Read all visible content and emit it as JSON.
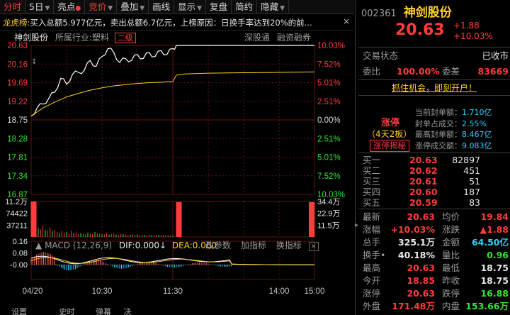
{
  "toolbar": {
    "items": [
      {
        "label": "分时",
        "active": true
      },
      {
        "label": "5日",
        "arrow": true
      },
      {
        "label": "亮点",
        "dot": true
      },
      {
        "label": "竞价",
        "active": true,
        "arrow": true
      },
      {
        "label": "叠加",
        "arrow": true
      },
      {
        "label": "画线"
      },
      {
        "label": "显示",
        "arrow": true
      },
      {
        "label": "复盘"
      },
      {
        "label": "简约"
      },
      {
        "label": "隐藏",
        "arrow": true
      }
    ]
  },
  "headline": {
    "label": "龙虎榜:",
    "text": "买入总额5.977亿元，卖出总额6.7亿元，上榜原因：日换手率达到20%的前...",
    "close": "×"
  },
  "chart": {
    "stock_name": "神剑股份",
    "industry_label": "所属行业:",
    "industry": "塑料",
    "tag": "二级",
    "link1": "深股通",
    "link2": "融资融券",
    "expand_icon": "↕"
  },
  "macd": {
    "title": "MACD (12,26,9)",
    "dif_label": "DIF:",
    "dif": "0.000",
    "dea_label": "DEA:",
    "dea": "0.000",
    "macd_label": "MACD:",
    "macd": "0.000",
    "btn_modify": "改参数",
    "btn_add": "加指标",
    "btn_switch": "换指标",
    "btn_close": "×"
  },
  "chart_data": [
    {
      "type": "line",
      "title": "",
      "x_ticks": [
        "04/20",
        "10:30",
        "11:30",
        "14:00",
        "15:00"
      ],
      "y_left_ticks": [
        "20.63",
        "20.16",
        "19.69",
        "19.22",
        "18.75",
        "18.28",
        "17.81",
        "17.34",
        "16.87"
      ],
      "y_right_ticks": [
        "10.03%",
        "7.52%",
        "5.01%",
        "2.51%",
        "0.00%",
        "2.51%",
        "5.01%",
        "7.52%",
        "10.03%"
      ],
      "ylim": [
        16.87,
        20.63
      ],
      "prev_close": 18.75,
      "series": [
        {
          "x": [
            0,
            5,
            10,
            15,
            20,
            25,
            30,
            35,
            40,
            45,
            50,
            55,
            60,
            65,
            70,
            75,
            80,
            85,
            90,
            95,
            100,
            105,
            110,
            115,
            120,
            123,
            130,
            150,
            180,
            210,
            240
          ],
          "values": [
            18.85,
            19.05,
            19.15,
            19.3,
            19.45,
            19.8,
            19.65,
            19.9,
            19.95,
            20.0,
            20.25,
            20.1,
            20.35,
            20.55,
            20.45,
            20.2,
            20.3,
            20.25,
            20.4,
            20.3,
            20.45,
            20.35,
            20.5,
            20.4,
            20.55,
            20.63,
            20.63,
            20.63,
            20.63,
            20.63,
            20.63
          ],
          "color": "#ffffff"
        },
        {
          "x": [
            0,
            5,
            10,
            20,
            30,
            40,
            50,
            60,
            70,
            80,
            90,
            100,
            110,
            120,
            123,
            130,
            150,
            180,
            210,
            240
          ],
          "values": [
            18.85,
            18.95,
            19.05,
            19.2,
            19.33,
            19.42,
            19.5,
            19.56,
            19.61,
            19.64,
            19.67,
            19.69,
            19.7,
            19.72,
            19.88,
            19.91,
            19.93,
            19.94,
            19.95,
            19.96
          ],
          "color": "#ffd21f"
        }
      ]
    },
    {
      "type": "bar",
      "title": "",
      "y_left_ticks": [
        "11.2万",
        "74422",
        "37211"
      ],
      "y_right_ticks": [
        "34.4万",
        "22.9万",
        "11.5万"
      ],
      "x": [
        0,
        2,
        4,
        6,
        8,
        10,
        12,
        14,
        16,
        18,
        20,
        22,
        24,
        26,
        28,
        30,
        32,
        34,
        36,
        38,
        40,
        42,
        44,
        46,
        48,
        50,
        52,
        54,
        56,
        58,
        60,
        62,
        64,
        66,
        68,
        70,
        72,
        74,
        76,
        78,
        80,
        82,
        84,
        86,
        88,
        90,
        92,
        94,
        96,
        98,
        100,
        102,
        104,
        106,
        108,
        110,
        112,
        114,
        116,
        118,
        120,
        123
      ],
      "values": [
        11.2,
        4.0,
        3.2,
        2.8,
        2.4,
        3.6,
        2.2,
        2.0,
        3.0,
        1.8,
        2.2,
        1.6,
        1.2,
        1.8,
        1.4,
        1.6,
        1.0,
        2.0,
        1.2,
        1.4,
        0.9,
        1.2,
        1.0,
        0.8,
        1.4,
        1.1,
        0.9,
        1.6,
        1.2,
        0.9,
        1.0,
        0.8,
        1.3,
        0.7,
        0.9,
        1.1,
        0.8,
        0.6,
        1.0,
        0.9,
        0.8,
        0.6,
        0.7,
        0.9,
        0.6,
        0.8,
        0.5,
        0.7,
        0.6,
        0.5,
        0.8,
        0.6,
        0.5,
        0.7,
        0.6,
        0.5,
        0.6,
        0.4,
        0.5,
        0.4,
        0.5,
        11.0
      ],
      "ylim": [
        0,
        11.2
      ],
      "unit": "万"
    },
    {
      "type": "bar",
      "title": "MACD (12,26,9)",
      "y_left_ticks": [
        "0.16",
        "0.08",
        "-0.00"
      ],
      "ylim": [
        -0.1,
        0.16
      ]
    }
  ],
  "stock": {
    "code": "002361",
    "name": "神剑股份",
    "price": "20.63",
    "change": "+1.88",
    "change_pct": "+10.03%"
  },
  "status": {
    "label": "交易状态",
    "value": "已收市"
  },
  "ratio": {
    "label1": "委比",
    "value1": "100.00%",
    "label2": "委差",
    "value2": "83669"
  },
  "promo": "抓住机会，即刻开户！",
  "limit_up": {
    "badge": "涨停",
    "streak": "（4天2板）",
    "reveal_button": "涨停揭秘",
    "rows": [
      {
        "label": "当前封单额：",
        "value": "1.710亿"
      },
      {
        "label": "封单占成交：",
        "value": "2.55%"
      },
      {
        "label": "最高封单额：",
        "value": "8.467亿"
      },
      {
        "label": "涨停成交额：",
        "value": "9.083亿"
      }
    ]
  },
  "order_book": {
    "bids": [
      {
        "label": "买一",
        "price": "20.63",
        "volume": "82897"
      },
      {
        "label": "买二",
        "price": "20.62",
        "volume": "451"
      },
      {
        "label": "买三",
        "price": "20.61",
        "volume": "51"
      },
      {
        "label": "买四",
        "price": "20.60",
        "volume": "187"
      },
      {
        "label": "买五",
        "price": "20.59",
        "volume": "83"
      }
    ]
  },
  "quote": {
    "rows": [
      {
        "l1": "最新",
        "v1": "20.63",
        "c1": "red",
        "l2": "均价",
        "v2": "19.84",
        "c2": "red"
      },
      {
        "l1": "涨幅",
        "v1": "+10.03%",
        "c1": "red",
        "l2": "涨跌",
        "v2": "▲1.88",
        "c2": "red"
      },
      {
        "l1": "总手",
        "v1": "325.1万",
        "c1": "wht",
        "l2": "金额",
        "v2": "64.50亿",
        "c2": "cyan"
      },
      {
        "l1": "换手•",
        "v1": "40.18%",
        "c1": "wht",
        "l2": "量比",
        "v2": "0.96",
        "c2": "grn"
      },
      {
        "l1": "最高",
        "v1": "20.63",
        "c1": "red",
        "l2": "最低",
        "v2": "18.75",
        "c2": "wht"
      },
      {
        "l1": "今开",
        "v1": "18.85",
        "c1": "red",
        "l2": "昨收",
        "v2": "18.75",
        "c2": "wht"
      },
      {
        "l1": "涨停",
        "v1": "20.63",
        "c1": "red",
        "l2": "跌停",
        "v2": "16.88",
        "c2": "grn"
      },
      {
        "l1": "外盘",
        "v1": "171.48万",
        "c1": "red",
        "l2": "内盘",
        "v2": "153.66万",
        "c2": "grn"
      }
    ]
  },
  "bottom_tabs": [
    "设置",
    "史时",
    "弹幕",
    "决"
  ],
  "colors": {
    "up": "#ff3b3b",
    "down": "#2ee62e",
    "avg": "#ffd21f",
    "price": "#ffffff",
    "grid": "#6a1010"
  }
}
